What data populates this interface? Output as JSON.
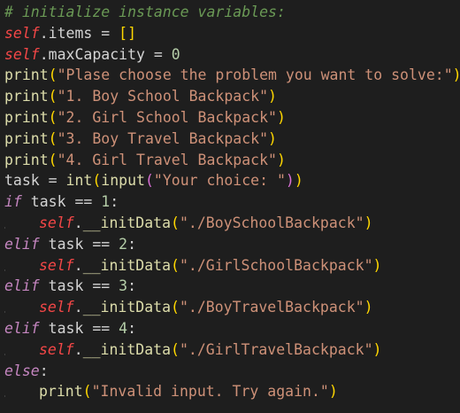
{
  "editor": {
    "background": "#1e1e1e",
    "lines": [
      {
        "tokens": [
          {
            "t": "# initialize instance variables:",
            "c": "cmt"
          }
        ]
      },
      {
        "tokens": [
          {
            "t": "self",
            "c": "slf"
          },
          {
            "t": ".items = ",
            "c": "var"
          },
          {
            "t": "[]",
            "c": "p1"
          }
        ]
      },
      {
        "tokens": [
          {
            "t": "self",
            "c": "slf"
          },
          {
            "t": ".maxCapacity = ",
            "c": "var"
          },
          {
            "t": "0",
            "c": "num"
          }
        ]
      },
      {
        "tokens": [
          {
            "t": "print",
            "c": "fn"
          },
          {
            "t": "(",
            "c": "p1"
          },
          {
            "t": "\"Plase choose the problem you want to solve:\"",
            "c": "str"
          },
          {
            "t": ")",
            "c": "p1"
          }
        ]
      },
      {
        "tokens": [
          {
            "t": "print",
            "c": "fn"
          },
          {
            "t": "(",
            "c": "p1"
          },
          {
            "t": "\"1. Boy School Backpack\"",
            "c": "str"
          },
          {
            "t": ")",
            "c": "p1"
          }
        ]
      },
      {
        "tokens": [
          {
            "t": "print",
            "c": "fn"
          },
          {
            "t": "(",
            "c": "p1"
          },
          {
            "t": "\"2. Girl School Backpack\"",
            "c": "str"
          },
          {
            "t": ")",
            "c": "p1"
          }
        ]
      },
      {
        "tokens": [
          {
            "t": "print",
            "c": "fn"
          },
          {
            "t": "(",
            "c": "p1"
          },
          {
            "t": "\"3. Boy Travel Backpack\"",
            "c": "str"
          },
          {
            "t": ")",
            "c": "p1"
          }
        ]
      },
      {
        "tokens": [
          {
            "t": "print",
            "c": "fn"
          },
          {
            "t": "(",
            "c": "p1"
          },
          {
            "t": "\"4. Girl Travel Backpack\"",
            "c": "str"
          },
          {
            "t": ")",
            "c": "p1"
          }
        ]
      },
      {
        "tokens": [
          {
            "t": "task = ",
            "c": "var"
          },
          {
            "t": "int",
            "c": "fn"
          },
          {
            "t": "(",
            "c": "p1"
          },
          {
            "t": "input",
            "c": "fn"
          },
          {
            "t": "(",
            "c": "p2"
          },
          {
            "t": "\"Your choice: \"",
            "c": "str"
          },
          {
            "t": ")",
            "c": "p2"
          },
          {
            "t": ")",
            "c": "p1"
          }
        ]
      },
      {
        "tokens": [
          {
            "t": "if",
            "c": "kw"
          },
          {
            "t": " task == ",
            "c": "var"
          },
          {
            "t": "1",
            "c": "num"
          },
          {
            "t": ":",
            "c": "var"
          }
        ]
      },
      {
        "indent": 1,
        "tokens": [
          {
            "t": "self",
            "c": "slf"
          },
          {
            "t": ".",
            "c": "var"
          },
          {
            "t": "__initData",
            "c": "fn"
          },
          {
            "t": "(",
            "c": "p1"
          },
          {
            "t": "\"./BoySchoolBackpack\"",
            "c": "str"
          },
          {
            "t": ")",
            "c": "p1"
          }
        ]
      },
      {
        "tokens": [
          {
            "t": "elif",
            "c": "kw"
          },
          {
            "t": " task == ",
            "c": "var"
          },
          {
            "t": "2",
            "c": "num"
          },
          {
            "t": ":",
            "c": "var"
          }
        ]
      },
      {
        "indent": 1,
        "tokens": [
          {
            "t": "self",
            "c": "slf"
          },
          {
            "t": ".",
            "c": "var"
          },
          {
            "t": "__initData",
            "c": "fn"
          },
          {
            "t": "(",
            "c": "p1"
          },
          {
            "t": "\"./GirlSchoolBackpack\"",
            "c": "str"
          },
          {
            "t": ")",
            "c": "p1"
          }
        ]
      },
      {
        "tokens": [
          {
            "t": "elif",
            "c": "kw"
          },
          {
            "t": " task == ",
            "c": "var"
          },
          {
            "t": "3",
            "c": "num"
          },
          {
            "t": ":",
            "c": "var"
          }
        ]
      },
      {
        "indent": 1,
        "tokens": [
          {
            "t": "self",
            "c": "slf"
          },
          {
            "t": ".",
            "c": "var"
          },
          {
            "t": "__initData",
            "c": "fn"
          },
          {
            "t": "(",
            "c": "p1"
          },
          {
            "t": "\"./BoyTravelBackpack\"",
            "c": "str"
          },
          {
            "t": ")",
            "c": "p1"
          }
        ]
      },
      {
        "tokens": [
          {
            "t": "elif",
            "c": "kw"
          },
          {
            "t": " task == ",
            "c": "var"
          },
          {
            "t": "4",
            "c": "num"
          },
          {
            "t": ":",
            "c": "var"
          }
        ]
      },
      {
        "indent": 1,
        "tokens": [
          {
            "t": "self",
            "c": "slf"
          },
          {
            "t": ".",
            "c": "var"
          },
          {
            "t": "__initData",
            "c": "fn"
          },
          {
            "t": "(",
            "c": "p1"
          },
          {
            "t": "\"./GirlTravelBackpack\"",
            "c": "str"
          },
          {
            "t": ")",
            "c": "p1"
          }
        ]
      },
      {
        "tokens": [
          {
            "t": "else",
            "c": "kw"
          },
          {
            "t": ":",
            "c": "var"
          }
        ]
      },
      {
        "indent": 1,
        "tokens": [
          {
            "t": "print",
            "c": "fn"
          },
          {
            "t": "(",
            "c": "p1"
          },
          {
            "t": "\"Invalid input. Try again.\"",
            "c": "str"
          },
          {
            "t": ")",
            "c": "p1"
          }
        ]
      }
    ]
  }
}
